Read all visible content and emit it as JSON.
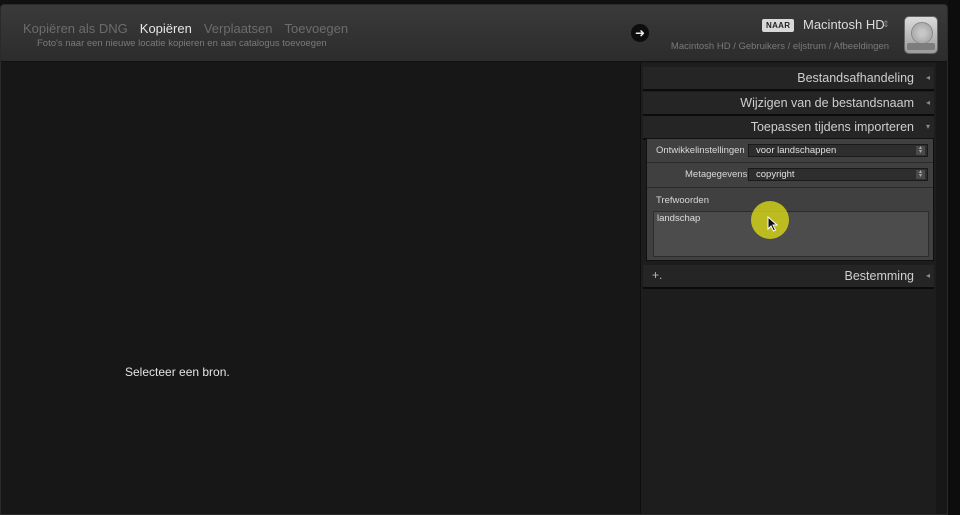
{
  "header": {
    "modes": [
      {
        "label": "Kopiëren als DNG",
        "active": false
      },
      {
        "label": "Kopiëren",
        "active": true
      },
      {
        "label": "Verplaatsen",
        "active": false
      },
      {
        "label": "Toevoegen",
        "active": false
      }
    ],
    "mode_description": "Foto's naar een nieuwe locatie kopieren en aan catalogus toevoegen",
    "to_badge": "NAAR",
    "destination_name": "Macintosh HD",
    "destination_path": "Macintosh HD / Gebruikers / eljstrum / Afbeeldingen",
    "go_icon": "arrow-right-icon"
  },
  "main": {
    "empty_message": "Selecteer een bron."
  },
  "panel": {
    "file_handling": "Bestandsafhandeling",
    "rename": "Wijzigen van de bestandsnaam",
    "apply_during_import": "Toepassen tijdens importeren",
    "develop_label": "Ontwikkelinstellingen",
    "develop_value": "voor landschappen",
    "metadata_label": "Metagegevens",
    "metadata_value": "copyright",
    "keywords_label": "Trefwoorden",
    "keywords_value": "landschap",
    "destination": "Bestemming",
    "add_symbol": "+."
  },
  "colors": {
    "cursor_highlight": "#dcdc14",
    "background": "#171717",
    "panel": "#1d1d1d"
  }
}
